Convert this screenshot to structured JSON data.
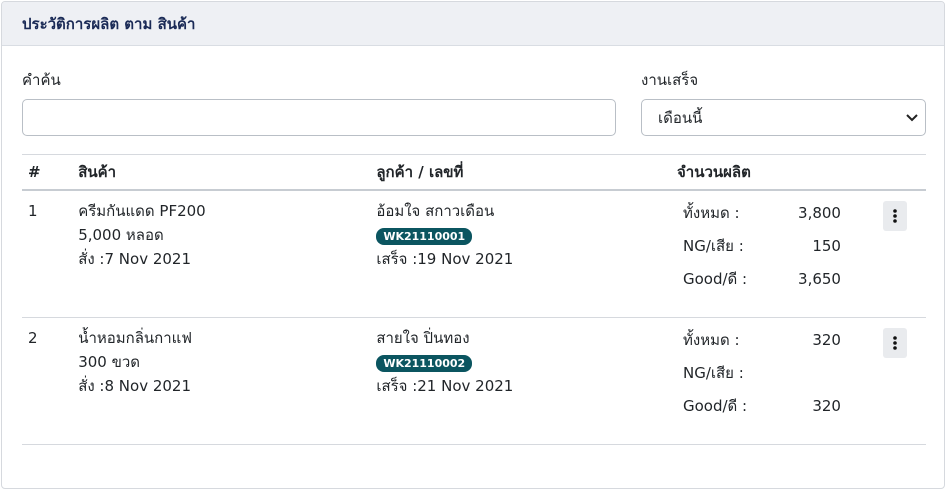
{
  "header": {
    "title": "ประวัติการผลิต ตาม สินค้า"
  },
  "filters": {
    "search_label": "คำค้น",
    "search_value": "",
    "search_placeholder": "",
    "status_label": "งานเสร็จ",
    "status_selected": "เดือนนี้"
  },
  "table": {
    "columns": [
      "#",
      "สินค้า",
      "ลูกค้า / เลขที่",
      "จำนวนผลิต"
    ],
    "rows": [
      {
        "index": "1",
        "product_name": "ครีมกันแดด PF200",
        "product_qty": "5,000 หลอด",
        "order_date": "สั่ง :7 Nov 2021",
        "customer": "อ้อมใจ สกาวเดือน",
        "work_no": "WK21110001",
        "done_date": "เสร็จ :19 Nov 2021",
        "total_label": "ทั้งหมด :",
        "total_value": "3,800",
        "ng_label": "NG/เสีย :",
        "ng_value": "150",
        "good_label": "Good/ดี :",
        "good_value": "3,650"
      },
      {
        "index": "2",
        "product_name": "น้ำหอมกลิ่นกาแฟ",
        "product_qty": "300 ขวด",
        "order_date": "สั่ง :8 Nov 2021",
        "customer": "สายใจ ปิ่นทอง",
        "work_no": "WK21110002",
        "done_date": "เสร็จ :21 Nov 2021",
        "total_label": "ทั้งหมด :",
        "total_value": "320",
        "ng_label": "NG/เสีย :",
        "ng_value": "",
        "good_label": "Good/ดี :",
        "good_value": "320"
      }
    ]
  },
  "icons": {
    "row_menu": "kebab-vertical-icon",
    "select_caret": "chevron-down-icon"
  },
  "colors": {
    "header_bg": "#eef0f4",
    "title_text": "#1a2a56",
    "badge_bg": "#0b5560"
  }
}
